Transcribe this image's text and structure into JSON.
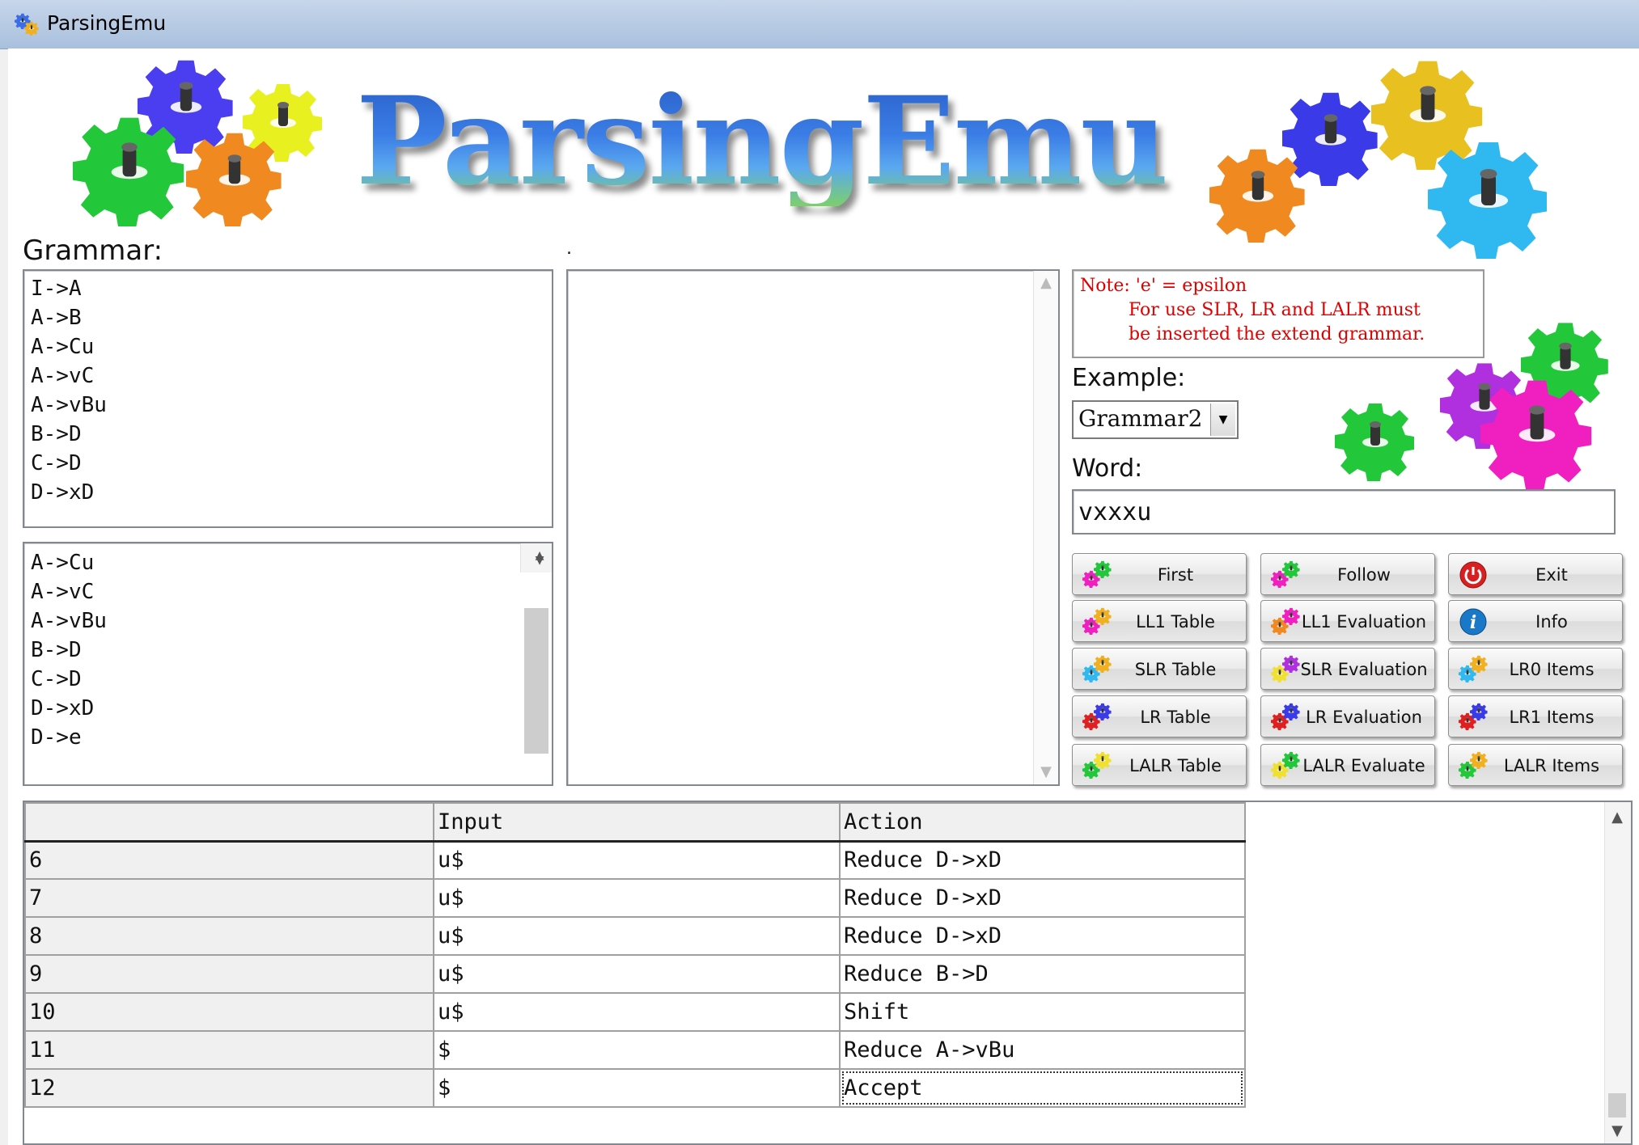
{
  "window": {
    "title": "ParsingEmu"
  },
  "logo": {
    "text": "ParsingEmu"
  },
  "grammar": {
    "label": "Grammar:",
    "rules": [
      "I->A",
      "A->B",
      "A->Cu",
      "A->vC",
      "A->vBu",
      "B->D",
      "C->D",
      "D->xD"
    ]
  },
  "dot_label": ".",
  "productions_list": [
    "A->Cu",
    "A->vC",
    "A->vBu",
    "B->D",
    "C->D",
    "D->xD",
    "D->e"
  ],
  "note": {
    "line1": "Note: 'e' = epsilon",
    "line2": "For use SLR,  LR  and  LALR  must",
    "line3": "be  inserted  the  extend  grammar."
  },
  "example": {
    "label": "Example:",
    "selected": "Grammar2"
  },
  "word": {
    "label": "Word:",
    "value": "vxxxu"
  },
  "buttons": [
    {
      "label": "First",
      "icon": "gear-icon"
    },
    {
      "label": "Follow",
      "icon": "gear-icon"
    },
    {
      "label": "Exit",
      "icon": "power-icon"
    },
    {
      "label": "LL1 Table",
      "icon": "gear-icon"
    },
    {
      "label": "LL1 Evaluation",
      "icon": "gear-icon"
    },
    {
      "label": "Info",
      "icon": "info-icon"
    },
    {
      "label": "SLR Table",
      "icon": "gear-icon"
    },
    {
      "label": "SLR Evaluation",
      "icon": "gear-icon"
    },
    {
      "label": "LR0 Items",
      "icon": "gear-icon"
    },
    {
      "label": "LR Table",
      "icon": "gear-icon"
    },
    {
      "label": "LR Evaluation",
      "icon": "gear-icon"
    },
    {
      "label": "LR1 Items",
      "icon": "gear-icon"
    },
    {
      "label": "LALR Table",
      "icon": "gear-icon"
    },
    {
      "label": "LALR Evaluate",
      "icon": "gear-icon"
    },
    {
      "label": "LALR Items",
      "icon": "gear-icon"
    }
  ],
  "results": {
    "headers": [
      "",
      "Input",
      "Action"
    ],
    "rows": [
      [
        "6",
        "u$",
        "Reduce  D->xD"
      ],
      [
        "7",
        "u$",
        "Reduce  D->xD"
      ],
      [
        "8",
        "u$",
        "Reduce  D->xD"
      ],
      [
        "9",
        "u$",
        "Reduce  B->D"
      ],
      [
        "10",
        "u$",
        "Shift"
      ],
      [
        "11",
        "$",
        "Reduce  A->vBu"
      ],
      [
        "12",
        "$",
        "Accept"
      ]
    ]
  },
  "colors": {
    "note_text": "#e00000",
    "titlebar": "#b8cbe3",
    "gear_green": "#22c83a",
    "gear_blue": "#3a3ae8",
    "gear_yellow": "#f0e030",
    "gear_orange": "#f08a20",
    "gear_pink": "#f020c0",
    "gear_cyan": "#30b8f0",
    "gear_purple": "#b030e0"
  }
}
